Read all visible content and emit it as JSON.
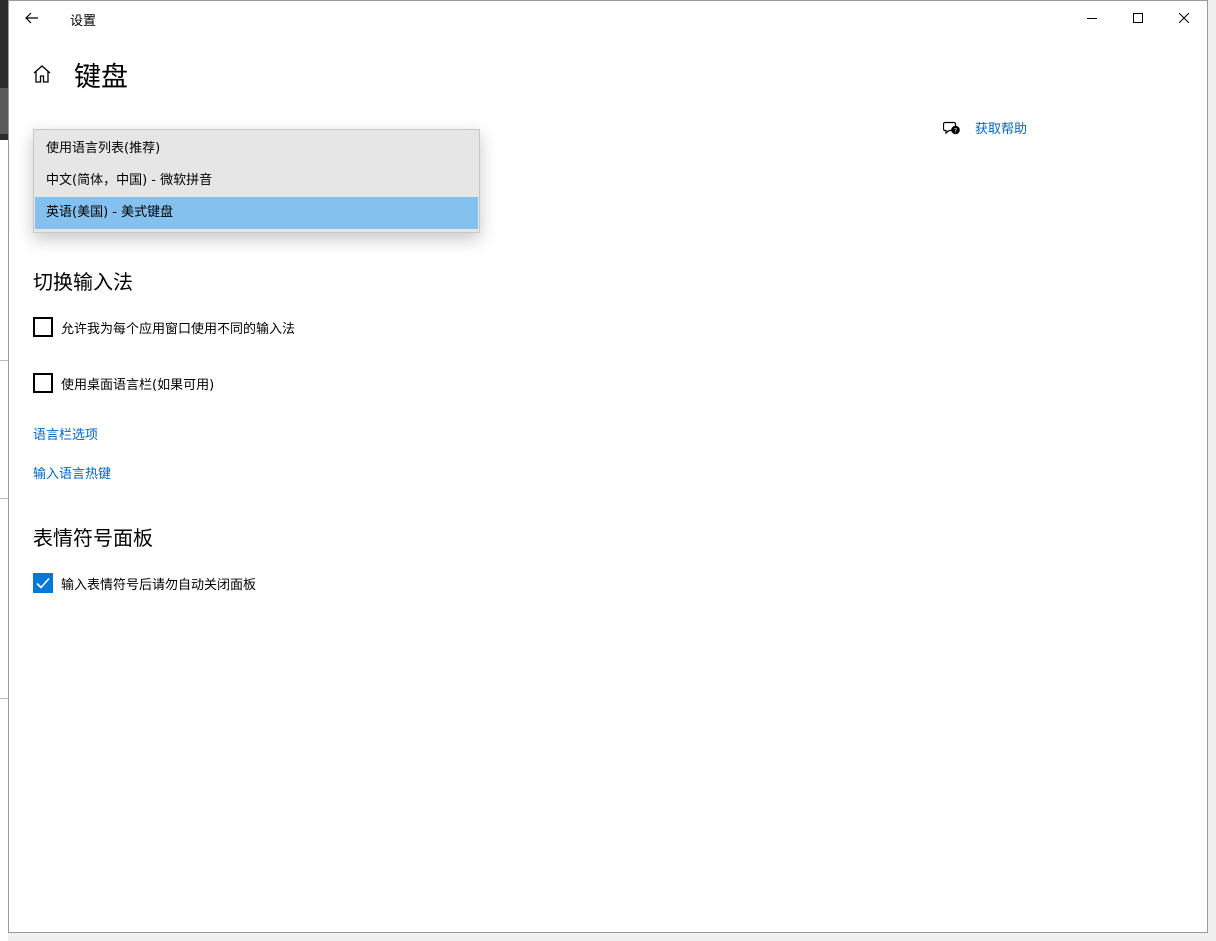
{
  "window": {
    "title": "设置"
  },
  "page": {
    "title": "键盘"
  },
  "help": {
    "label": "获取帮助"
  },
  "dropdown": {
    "options": [
      {
        "label": "使用语言列表(推荐)"
      },
      {
        "label": "中文(简体，中国) - 微软拼音"
      },
      {
        "label": "英语(美国) - 美式键盘"
      }
    ]
  },
  "switch_section": {
    "title": "切换输入法",
    "checkboxes": [
      {
        "label": "允许我为每个应用窗口使用不同的输入法",
        "checked": false
      },
      {
        "label": "使用桌面语言栏(如果可用)",
        "checked": false
      }
    ],
    "links": [
      {
        "label": "语言栏选项"
      },
      {
        "label": "输入语言热键"
      }
    ]
  },
  "emoji_section": {
    "title": "表情符号面板",
    "checkboxes": [
      {
        "label": "输入表情符号后请勿自动关闭面板",
        "checked": true
      }
    ]
  },
  "colors": {
    "accent": "#0078d7",
    "link": "#0067c0",
    "selection": "#85c1ee"
  }
}
